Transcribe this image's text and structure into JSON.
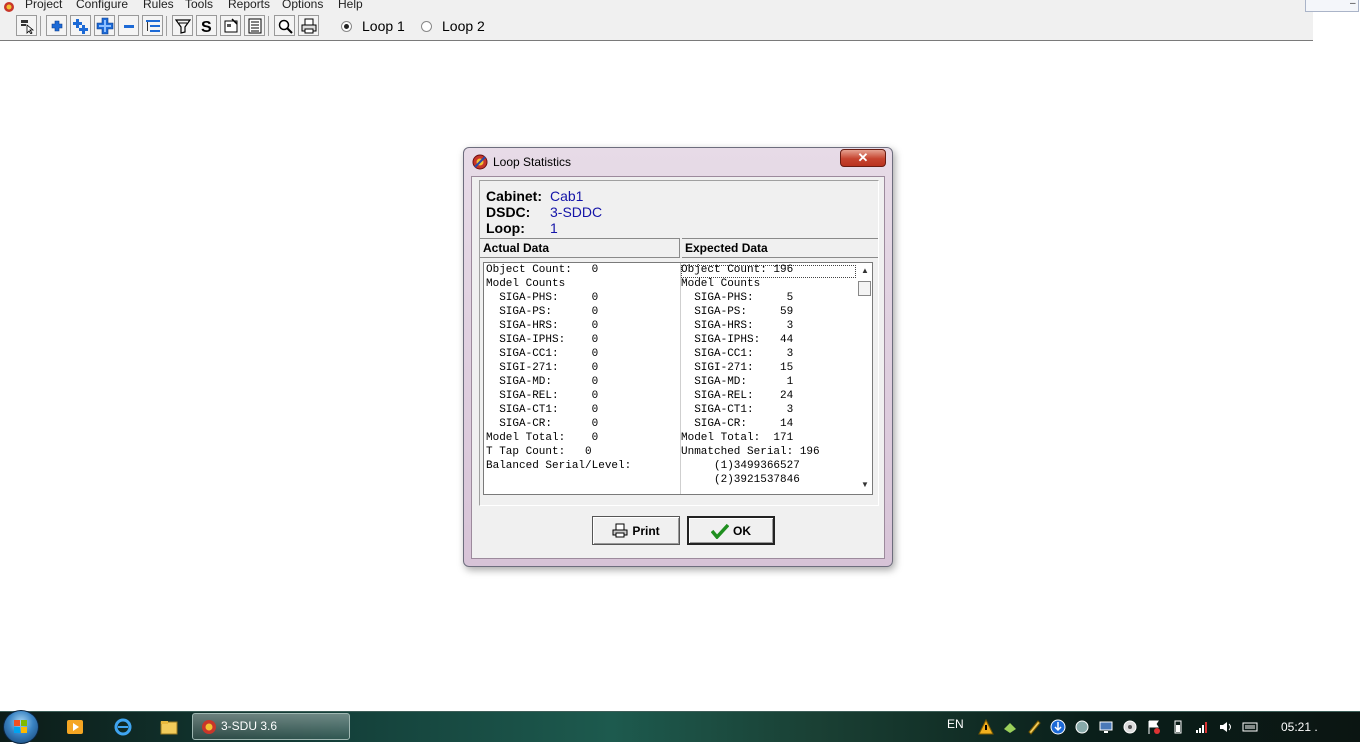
{
  "menu": {
    "items": [
      "Project",
      "Configure",
      "Rules",
      "Tools",
      "Reports",
      "Options",
      "Help"
    ]
  },
  "toolbar": {
    "buttons": [
      "pointer-icon",
      "add-icon",
      "add-multiple-icon",
      "add-branch-icon",
      "remove-icon",
      "tree-icon",
      "funnel-icon",
      "s-icon",
      "properties-icon",
      "list-icon",
      "zoom-icon",
      "print-icon"
    ],
    "loop_options": [
      {
        "label": "Loop 1",
        "selected": true
      },
      {
        "label": "Loop 2",
        "selected": false
      }
    ]
  },
  "dialog": {
    "title": "Loop Statistics",
    "close_glyph": "✕",
    "info": {
      "cabinet_label": "Cabinet:",
      "cabinet_value": "Cab1",
      "dsdc_label": "DSDC:",
      "dsdc_value": "3-SDDC",
      "loop_label": "Loop:",
      "loop_value": "1"
    },
    "actual_header": "Actual Data",
    "expected_header": "Expected Data",
    "actual_lines": [
      "Object Count:   0",
      "Model Counts",
      "  SIGA-PHS:     0",
      "  SIGA-PS:      0",
      "  SIGA-HRS:     0",
      "  SIGA-IPHS:    0",
      "  SIGA-CC1:     0",
      "  SIGI-271:     0",
      "  SIGA-MD:      0",
      "  SIGA-REL:     0",
      "  SIGA-CT1:     0",
      "  SIGA-CR:      0",
      "Model Total:    0",
      "T Tap Count:   0",
      "Balanced Serial/Level:"
    ],
    "expected_lines": [
      "Object Count: 196",
      "Model Counts",
      "  SIGA-PHS:     5",
      "  SIGA-PS:     59",
      "  SIGA-HRS:     3",
      "  SIGA-IPHS:   44",
      "  SIGA-CC1:     3",
      "  SIGI-271:    15",
      "  SIGA-MD:      1",
      "  SIGA-REL:    24",
      "  SIGA-CT1:     3",
      "  SIGA-CR:     14",
      "Model Total:  171",
      "Unmatched Serial: 196",
      "     (1)3499366527",
      "     (2)3921537846"
    ],
    "print_label": "Print",
    "ok_label": "OK"
  },
  "taskbar": {
    "task_label": "3-SDU 3.6",
    "language": "EN",
    "clock": "05:21 ."
  },
  "colors": {
    "value_text": "#1414a8",
    "ok_check": "#1f8f1f",
    "close_button": "#c6442f"
  }
}
